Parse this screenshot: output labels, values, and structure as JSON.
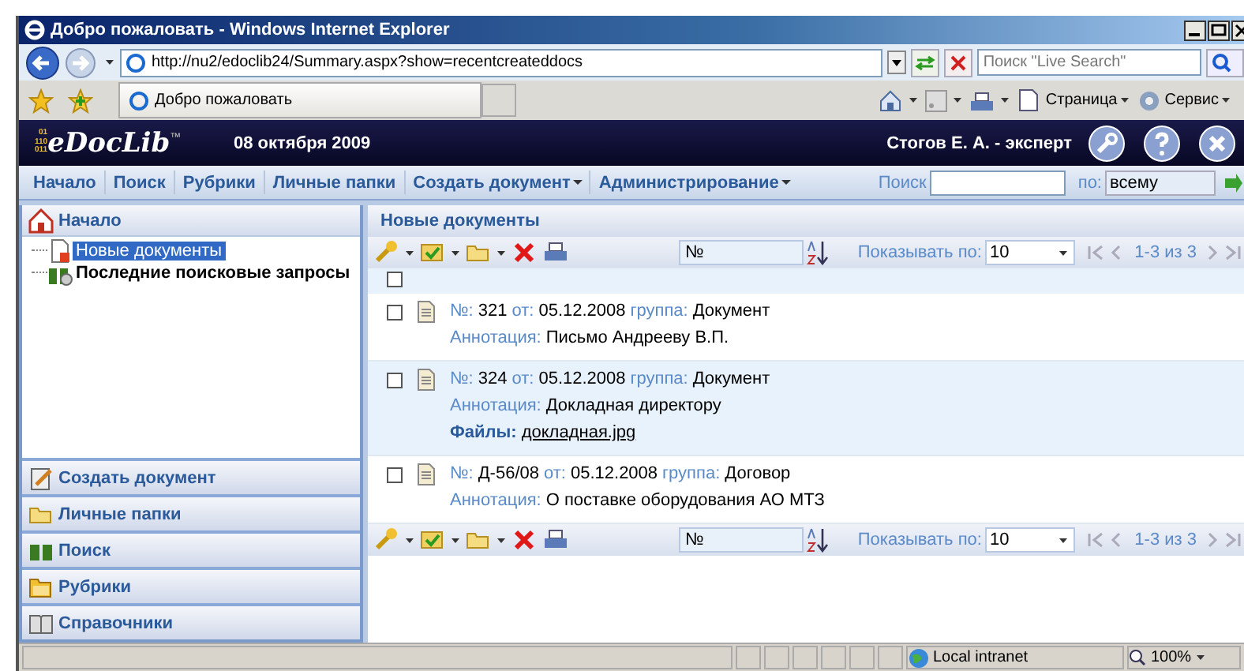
{
  "browser": {
    "title": "Добро пожаловать - Windows Internet Explorer",
    "address": "http://nu2/edoclib24/Summary.aspx?show=recentcreateddocs",
    "search_placeholder": "Поиск \"Live Search\"",
    "tab_title": "Добро пожаловать",
    "commands": [
      {
        "label": "Страница"
      },
      {
        "label": "Сервис"
      }
    ]
  },
  "app": {
    "logo": "eDocLib",
    "logo_mark": "™",
    "logo_digits": [
      "01",
      "110",
      "011"
    ],
    "date": "08 октября 2009",
    "user": "Стогов Е. А. - эксперт"
  },
  "menu": [
    {
      "label": "Начало",
      "dropdown": false
    },
    {
      "label": "Поиск",
      "dropdown": false
    },
    {
      "label": "Рубрики",
      "dropdown": false
    },
    {
      "label": "Личные папки",
      "dropdown": false
    },
    {
      "label": "Создать документ",
      "dropdown": true
    },
    {
      "label": "Администрирование",
      "dropdown": true
    }
  ],
  "search": {
    "label": "Поиск",
    "by_label": "по:",
    "by_value": "всему"
  },
  "sidebar": {
    "title": "Начало",
    "tree": [
      {
        "label": "Новые документы",
        "selected": true,
        "kind": "new"
      },
      {
        "label": "Последние поисковые запросы",
        "selected": false,
        "kind": "search"
      }
    ],
    "sections": [
      {
        "label": "Создать документ",
        "kind": "create"
      },
      {
        "label": "Личные папки",
        "kind": "folder"
      },
      {
        "label": "Поиск",
        "kind": "search"
      },
      {
        "label": "Рубрики",
        "kind": "rubric"
      },
      {
        "label": "Справочники",
        "kind": "book"
      }
    ]
  },
  "content": {
    "title": "Новые документы",
    "select_all": {
      "checked": false
    },
    "toolbars": [
      {
        "sort_field": "№",
        "per_page_label": "Показывать по:",
        "per_page": "10",
        "pager": "1-3 из 3"
      },
      {
        "sort_field": "№",
        "per_page_label": "Показывать по:",
        "per_page": "10",
        "pager": "1-3 из 3"
      }
    ],
    "documents": [
      {
        "checked": false,
        "selected": false,
        "lines": [
          [
            {
              "label": "№:",
              "value": "321"
            },
            {
              "label": "от:",
              "value": "05.12.2008"
            },
            {
              "label": "группа:",
              "value": "Документ"
            }
          ],
          [
            {
              "label": "Аннотация:",
              "value": "Письмо Андрееву В.П."
            }
          ]
        ]
      },
      {
        "checked": false,
        "selected": true,
        "lines": [
          [
            {
              "label": "№:",
              "value": "324"
            },
            {
              "label": "от:",
              "value": "05.12.2008"
            },
            {
              "label": "группа:",
              "value": "Документ"
            }
          ],
          [
            {
              "label": "Аннотация:",
              "value": "Докладная директору"
            }
          ],
          [
            {
              "label": "Файлы:",
              "value": "докладная.jpg",
              "kind": "file"
            }
          ]
        ]
      },
      {
        "checked": false,
        "selected": false,
        "lines": [
          [
            {
              "label": "№:",
              "value": "Д-56/08"
            },
            {
              "label": "от:",
              "value": "05.12.2008"
            },
            {
              "label": "группа:",
              "value": "Договор"
            }
          ],
          [
            {
              "label": "Аннотация:",
              "value": "О поставке оборудования АО МТЗ"
            }
          ]
        ]
      }
    ]
  },
  "status_bar": {
    "zone": "Local intranet",
    "zoom": "100%"
  }
}
